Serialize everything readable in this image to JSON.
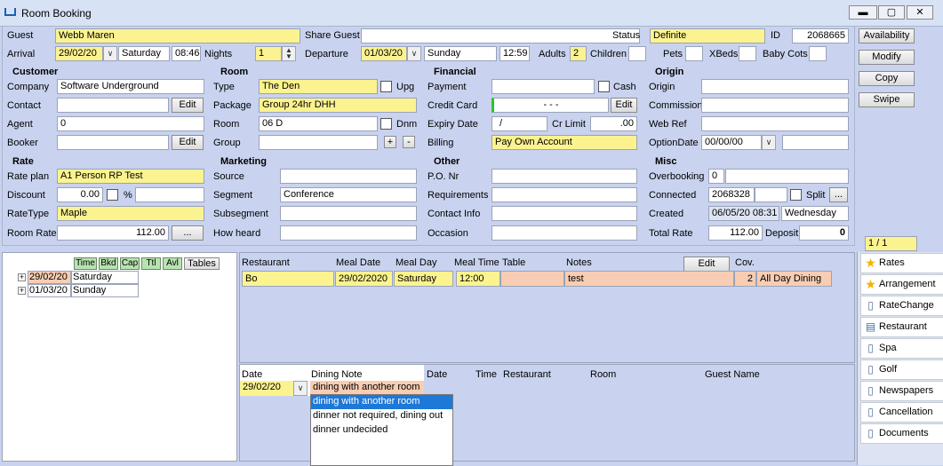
{
  "window": {
    "title": "Room Booking"
  },
  "guest": {
    "guest_label": "Guest",
    "guest_value": "Webb Maren",
    "share_guest_label": "Share Guest",
    "share_guest_value": "",
    "status_label": "Status",
    "status_value": "Definite",
    "id_label": "ID",
    "id_value": "2068665"
  },
  "arrival": {
    "label": "Arrival",
    "date": "29/02/20",
    "day": "Saturday",
    "time": "08:46",
    "nights_label": "Nights",
    "nights": "1",
    "departure_label": "Departure",
    "departure_date": "01/03/20",
    "departure_day": "Sunday",
    "departure_time": "12:59",
    "adults_label": "Adults",
    "adults": "2",
    "children_label": "Children",
    "children": "",
    "pets_label": "Pets",
    "pets": "",
    "xbeds_label": "XBeds",
    "xbeds": "",
    "babycots_label": "Baby Cots",
    "babycots": ""
  },
  "actions": {
    "availability": "Availability",
    "modify": "Modify",
    "copy": "Copy",
    "swipe": "Swipe"
  },
  "customer": {
    "header": "Customer",
    "company_label": "Company",
    "company": "Software Underground",
    "contact_label": "Contact",
    "contact": "",
    "edit": "Edit",
    "agent_label": "Agent",
    "agent": "0",
    "booker_label": "Booker",
    "booker": ""
  },
  "room": {
    "header": "Room",
    "type_label": "Type",
    "type": "The Den",
    "upg": "Upg",
    "package_label": "Package",
    "package": "Group 24hr DHH",
    "room_label": "Room",
    "room": "06 D",
    "dnm": "Dnm",
    "group_label": "Group",
    "group": "",
    "plus": "+",
    "minus": "-"
  },
  "financial": {
    "header": "Financial",
    "payment_label": "Payment",
    "payment": "",
    "cash": "Cash",
    "credit_card_label": "Credit Card",
    "credit_card": "-   -   -",
    "edit": "Edit",
    "expiry_label": "Expiry Date",
    "expiry": "/",
    "cr_limit_label": "Cr Limit",
    "cr_limit": ".00",
    "billing_label": "Billing",
    "billing": "Pay Own Account"
  },
  "origin": {
    "header": "Origin",
    "origin_label": "Origin",
    "origin": "",
    "commission_label": "Commission",
    "commission": "",
    "webref_label": "Web Ref",
    "webref": "",
    "optiondate_label": "OptionDate",
    "optiondate": "00/00/00",
    "optiondate_extra": ""
  },
  "rate": {
    "header": "Rate",
    "rateplan_label": "Rate plan",
    "rateplan": "A1 Person RP Test",
    "discount_label": "Discount",
    "discount": "0.00",
    "pct": "%",
    "discount_extra": "",
    "ratetype_label": "RateType",
    "ratetype": "Maple",
    "roomrate_label": "Room Rate",
    "roomrate": "112.00",
    "more": "..."
  },
  "marketing": {
    "header": "Marketing",
    "source_label": "Source",
    "source": "",
    "segment_label": "Segment",
    "segment": "Conference",
    "subsegment_label": "Subsegment",
    "subsegment": "",
    "howheard_label": "How heard",
    "howheard": ""
  },
  "other": {
    "header": "Other",
    "po_label": "P.O. Nr",
    "po": "",
    "requirements_label": "Requirements",
    "requirements": "",
    "contact_info_label": "Contact Info",
    "contact_info": "",
    "occasion_label": "Occasion",
    "occasion": ""
  },
  "misc": {
    "header": "Misc",
    "overbooking_label": "Overbooking",
    "overbooking": "0",
    "overbooking_extra": "",
    "connected_label": "Connected",
    "connected": "2068328",
    "connected_extra": "",
    "split": "Split",
    "more": "...",
    "created_label": "Created",
    "created": "06/05/20 08:31",
    "created_day": "Wednesday",
    "totalrate_label": "Total Rate",
    "totalrate": "112.00",
    "deposit_label": "Deposit",
    "deposit": "0"
  },
  "pager": "1 / 1",
  "tree": {
    "tabs": [
      "Time",
      "Bkd",
      "Cap",
      "Ttl",
      "Avl"
    ],
    "tables_btn": "Tables",
    "rows": [
      {
        "date": "29/02/20",
        "day": "Saturday"
      },
      {
        "date": "01/03/20",
        "day": "Sunday"
      }
    ]
  },
  "restaurant": {
    "headers": [
      "Restaurant",
      "Meal Date",
      "Meal Day",
      "Meal Time",
      "Table",
      "Notes",
      "Cov."
    ],
    "edit": "Edit",
    "row": {
      "restaurant": "Bo",
      "meal_date": "29/02/2020",
      "meal_day": "Saturday",
      "meal_time": "12:00",
      "table": "",
      "notes": "test",
      "cov": "2",
      "extra": "All Day Dining"
    }
  },
  "dining": {
    "date_label": "Date",
    "note_label": "Dining Note",
    "date": "29/02/20",
    "note": "dining with another room",
    "options": [
      "dining with another room",
      "dinner not required, dining out",
      "dinner undecided"
    ],
    "right_headers": [
      "Date",
      "Time",
      "Restaurant",
      "Room",
      "Guest Name"
    ]
  },
  "sidebar": [
    {
      "label": "Rates",
      "icon": "star-icon"
    },
    {
      "label": "Arrangement",
      "icon": "star-icon"
    },
    {
      "label": "RateChange",
      "icon": "document-icon"
    },
    {
      "label": "Restaurant",
      "icon": "restaurant-icon"
    },
    {
      "label": "Spa",
      "icon": "document-icon"
    },
    {
      "label": "Golf",
      "icon": "document-icon"
    },
    {
      "label": "Newspapers",
      "icon": "document-icon"
    },
    {
      "label": "Cancellation",
      "icon": "document-icon"
    },
    {
      "label": "Documents",
      "icon": "document-icon"
    }
  ],
  "colors": {
    "panel": "#c9d3ef",
    "highlight": "#fbf38f",
    "pink": "#f8cdb3",
    "selection": "#1e78d8"
  }
}
